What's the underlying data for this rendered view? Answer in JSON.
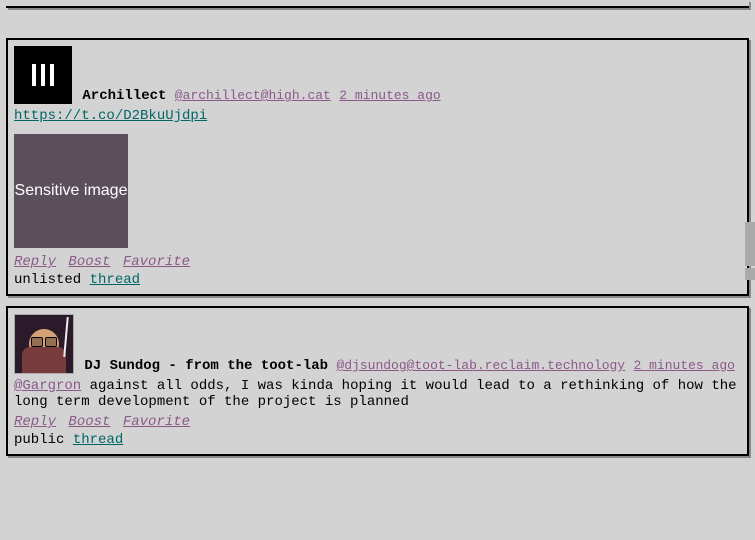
{
  "posts": [
    {
      "display_name": "Archillect",
      "handle": "@archillect@high.cat",
      "timestamp": "2 minutes ago",
      "body_link": "https://t.co/D2BkuUjdpi",
      "sensitive_label": "Sensitive image",
      "actions": {
        "reply": "Reply",
        "boost": "Boost",
        "favorite": "Favorite"
      },
      "visibility": "unlisted",
      "thread": "thread"
    },
    {
      "display_name": "DJ Sundog - from the toot-lab",
      "handle": "@djsundog@toot-lab.reclaim.technology",
      "timestamp": "2 minutes ago",
      "mention": "@Gargron",
      "body_text": " against all odds, I was kinda hoping it would lead to a rethinking of how the long term development of the project is planned",
      "actions": {
        "reply": "Reply",
        "boost": "Boost",
        "favorite": "Favorite"
      },
      "visibility": "public",
      "thread": "thread"
    }
  ]
}
